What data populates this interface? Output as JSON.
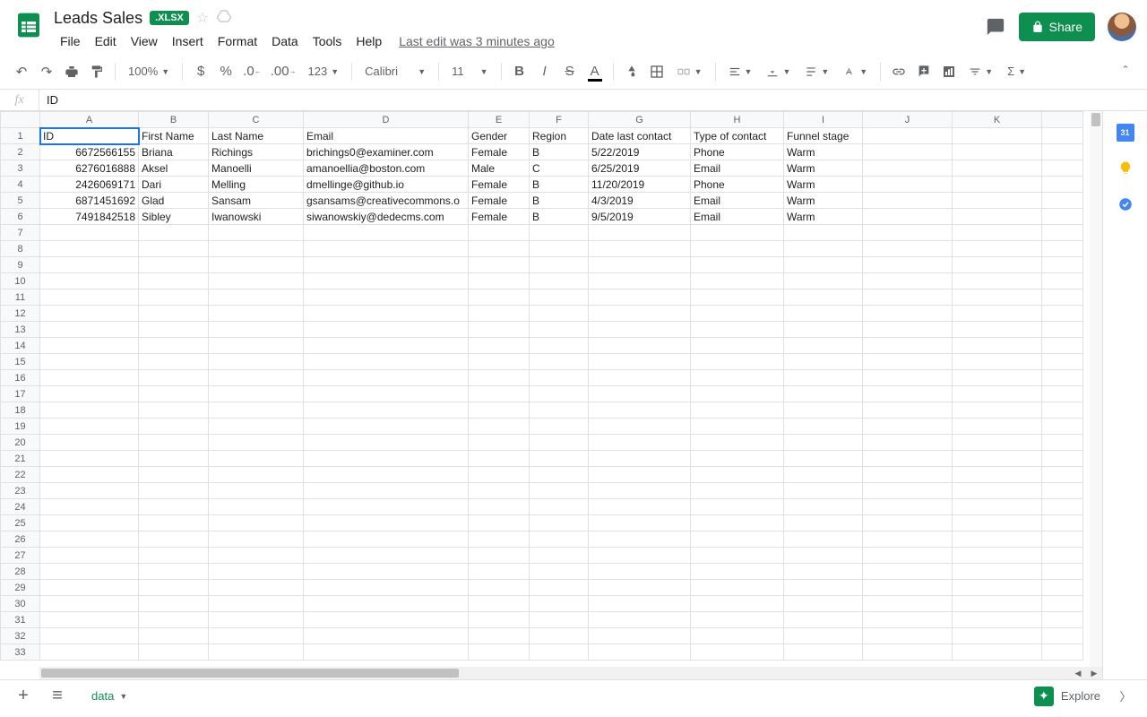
{
  "doc": {
    "title": "Leads Sales",
    "badge": ".XLSX",
    "last_edit": "Last edit was 3 minutes ago"
  },
  "menus": [
    "File",
    "Edit",
    "View",
    "Insert",
    "Format",
    "Data",
    "Tools",
    "Help"
  ],
  "share_label": "Share",
  "toolbar": {
    "zoom": "100%",
    "format_as": "123",
    "font": "Calibri",
    "font_size": "11"
  },
  "formula_bar": {
    "value": "ID"
  },
  "columns": [
    "A",
    "B",
    "C",
    "D",
    "E",
    "F",
    "G",
    "H",
    "I",
    "J",
    "K",
    ""
  ],
  "headers": [
    "ID",
    "First Name",
    "Last Name",
    "Email",
    "Gender",
    "Region",
    "Date last contact",
    "Type of contact",
    "Funnel stage"
  ],
  "rows": [
    {
      "id": "6672566155",
      "first": "Briana",
      "last": "Richings",
      "email": "brichings0@examiner.com",
      "gender": "Female",
      "region": "B",
      "date": "5/22/2019",
      "type": "Phone",
      "stage": "Warm"
    },
    {
      "id": "6276016888",
      "first": "Aksel",
      "last": "Manoelli",
      "email": "amanoellia@boston.com",
      "gender": "Male",
      "region": "C",
      "date": "6/25/2019",
      "type": "Email",
      "stage": "Warm"
    },
    {
      "id": "2426069171",
      "first": "Dari",
      "last": "Melling",
      "email": "dmellinge@github.io",
      "gender": "Female",
      "region": "B",
      "date": "11/20/2019",
      "type": "Phone",
      "stage": "Warm"
    },
    {
      "id": "6871451692",
      "first": "Glad",
      "last": "Sansam",
      "email": "gsansams@creativecommons.o",
      "gender": "Female",
      "region": "B",
      "date": "4/3/2019",
      "type": "Email",
      "stage": "Warm"
    },
    {
      "id": "7491842518",
      "first": "Sibley",
      "last": "Iwanowski",
      "email": "siwanowskiy@dedecms.com",
      "gender": "Female",
      "region": "B",
      "date": "9/5/2019",
      "type": "Email",
      "stage": "Warm"
    }
  ],
  "empty_row_count": 27,
  "sheet_tab": "data",
  "explore_label": "Explore",
  "side_calendar_day": "31"
}
